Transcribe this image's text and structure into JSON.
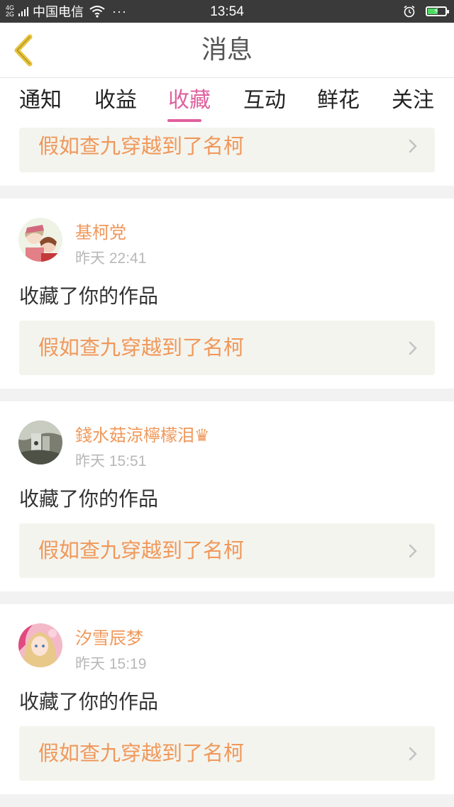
{
  "status_bar": {
    "network_top": "4G",
    "network_bottom": "2G",
    "carrier": "中国电信",
    "more": "···",
    "time": "13:54",
    "icons": [
      "signal-bars-icon",
      "wifi-icon",
      "alarm-clock-icon",
      "battery-charging-icon"
    ],
    "battery_level": 0.6,
    "battery_color": "#4cd964"
  },
  "header": {
    "title": "消息",
    "back_icon": "chevron-left-icon",
    "back_color": "#e8c33a"
  },
  "tabs": [
    {
      "label": "通知",
      "active": false
    },
    {
      "label": "收益",
      "active": false
    },
    {
      "label": "收藏",
      "active": true
    },
    {
      "label": "互动",
      "active": false
    },
    {
      "label": "鲜花",
      "active": false
    },
    {
      "label": "关注",
      "active": false
    }
  ],
  "accent_color": "#e0609e",
  "name_color": "#f0985a",
  "partial_card": {
    "work_title": "假如查九穿越到了名柯"
  },
  "notifications": [
    {
      "user": "基柯党",
      "time": "昨天 22:41",
      "action": "收藏了你的作品",
      "work_title": "假如查九穿越到了名柯",
      "avatar_icon": "anime-avatar-icon"
    },
    {
      "user": "錢水菇涼檸檬泪♛",
      "time": "昨天 15:51",
      "action": "收藏了你的作品",
      "work_title": "假如查九穿越到了名柯",
      "avatar_icon": "photo-avatar-icon"
    },
    {
      "user": "汐雪辰梦",
      "time": "昨天 15:19",
      "action": "收藏了你的作品",
      "work_title": "假如查九穿越到了名柯",
      "avatar_icon": "anime-avatar-icon"
    }
  ]
}
